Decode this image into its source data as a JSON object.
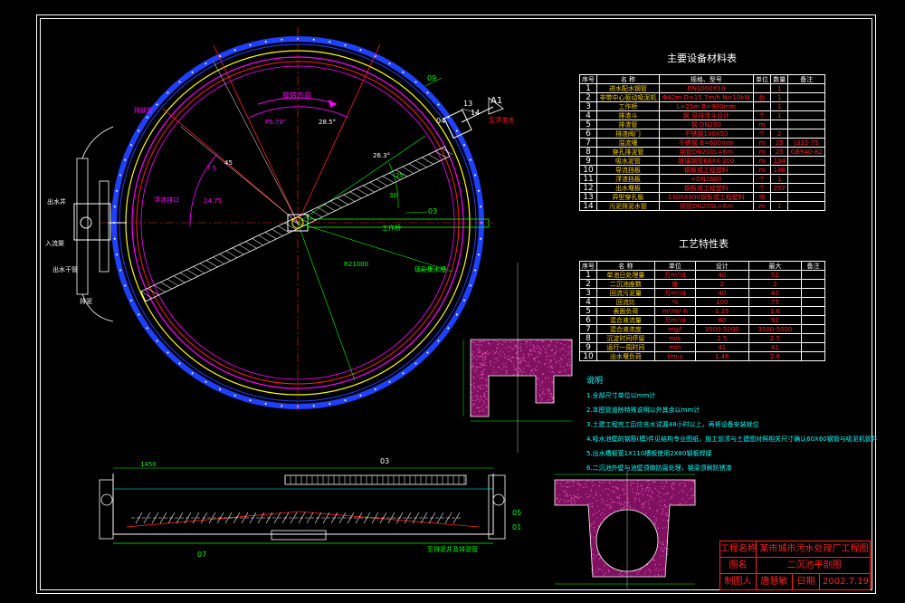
{
  "equipment_table": {
    "title": "主要设备材料表",
    "headers": [
      "序号",
      "名  称",
      "规格、型号",
      "单位",
      "数量",
      "备注"
    ],
    "rows": [
      [
        "1",
        "进水配水钢管",
        "DN1000X10",
        "",
        "1",
        ""
      ],
      [
        "2",
        "非带中心驱动吸泥机",
        "Ф42m D=15.7m/h N=10kW",
        "台",
        "1",
        ""
      ],
      [
        "3",
        "工作桥",
        "L=25m B=900mm",
        "",
        "1",
        ""
      ],
      [
        "4",
        "排渣斗",
        "钢 见排渣斗设计",
        "个",
        "1",
        ""
      ],
      [
        "5",
        "排渣管",
        "钢 DN200",
        "m",
        "",
        ""
      ],
      [
        "6",
        "排渣阀门",
        "不锈钢100X50",
        "个",
        "2",
        ""
      ],
      [
        "7",
        "溢流堰",
        "不锈钢 B=600mm",
        "m",
        "25",
        "J332-75"
      ],
      [
        "8",
        "穿孔排泥管",
        "钢管DN200L=6m",
        "m",
        "25",
        "GB940-82"
      ],
      [
        "9",
        "吸水泥管",
        "玻璃钢管68X4-300",
        "m",
        "134",
        ""
      ],
      [
        "10",
        "导流挡板",
        "钢板或工程塑料",
        "m",
        "148",
        ""
      ],
      [
        "11",
        "浮渣挡板",
        "=DN1600",
        "个",
        "1",
        ""
      ],
      [
        "12",
        "出水堰板",
        "钢板或工程塑料",
        "个",
        "257",
        ""
      ],
      [
        "13",
        "异型穿孔板",
        "1300X900钢板或工程塑料",
        "块",
        "",
        ""
      ],
      [
        "14",
        "污泥排泥水管",
        "钢管DN200L=6m",
        "m",
        "1",
        ""
      ]
    ]
  },
  "process_table": {
    "title": "工艺特性表",
    "headers": [
      "序号",
      "名  称",
      "单位",
      "设计",
      "最大",
      "备注"
    ],
    "rows": [
      [
        "1",
        "单池日处理量",
        "万m³/d",
        "40",
        "52",
        ""
      ],
      [
        "2",
        "二沉池座数",
        "座",
        "2",
        "2",
        ""
      ],
      [
        "3",
        "回流污泥量",
        "万m³/d",
        "40",
        "40",
        ""
      ],
      [
        "4",
        "回流比",
        "%",
        "100",
        "75",
        ""
      ],
      [
        "5",
        "表面负荷",
        "m³/m²·h",
        "1.25",
        "1.6",
        ""
      ],
      [
        "6",
        "混合液流量",
        "万m³/d",
        "80",
        "92",
        ""
      ],
      [
        "7",
        "混合液浓度",
        "mg/l",
        "3500-5000",
        "3500-5000",
        ""
      ],
      [
        "8",
        "沉淀时间停留",
        "m/s",
        "2.5",
        "2.5",
        ""
      ],
      [
        "9",
        "运行一周时间",
        "min",
        "41",
        "41",
        ""
      ],
      [
        "10",
        "出水堰负荷",
        "l/m·s",
        "1.46",
        "2.6",
        ""
      ]
    ]
  },
  "notes": {
    "title": "说明",
    "items": [
      "1.全部尺寸单位以mm计",
      "2.本图管道除特殊说明以外其余以mm计",
      "3.土建工程完工后应充水试漏48小时以上，再将设备安装就位",
      "4.吸水池壁的钢筋(模)件见结构专业图纸，施工前须与土建图对照相关尺寸确认60X60钢管与吸泥机管件",
      "5.出水槽板宽1X110槽板使用2X80钢板焊接",
      "6.二沉池外壁与池壁须做防腐处理，钢梁须刷防锈漆"
    ]
  },
  "plan_labels": {
    "rotation": "旋转方向",
    "drain_left": "排放管",
    "outlet_pipe": "出水井",
    "inlet": "入流渠",
    "outlet_trough": "出水干管",
    "sludge_pipe": "排泥",
    "scum_outlet": "浮渣排口",
    "walkway": "工作桥",
    "weir": "环形集水槽",
    "scum_left": "浮渣管",
    "scum_right": "至浮渣池",
    "section_mark": "A1",
    "angle_a": "28.5°",
    "angle_b": "26.3°",
    "angle_c": "P5.79°",
    "angle_d": "7.5",
    "angle_e": "45",
    "angle_f": "30",
    "angle_g": "24.75",
    "angle_h": "25",
    "radius": "R21000",
    "callout_03": "03",
    "callout_04": "04",
    "callout_09": "09",
    "callout_13": "13",
    "callout_14": "14",
    "callout_07": "07",
    "callout_02": "02",
    "callout_11": "11"
  },
  "section_labels": {
    "callout_03": "03",
    "callout_07": "07",
    "callout_01": "01",
    "callout_05": "05",
    "bottom_note": "至排泥井及排泥管",
    "dim_top": "1450"
  },
  "title_block": {
    "project_label": "工程名称",
    "project_value": "某市城市污水处理厂工程图",
    "drawing_label": "图名",
    "drawing_value": "二沉池平剖图",
    "drafter_label": "制图人",
    "drafter_value": "唐慧敏",
    "date_label": "日期",
    "date_value": "2002.7.19"
  },
  "colors": {
    "background": "#000000",
    "frame": "#ffffff",
    "red": "#ff2020",
    "yellow": "#ffff00",
    "cyan": "#00ffff",
    "magenta": "#ff00ff",
    "green": "#00ff00",
    "blue": "#2040ff"
  }
}
